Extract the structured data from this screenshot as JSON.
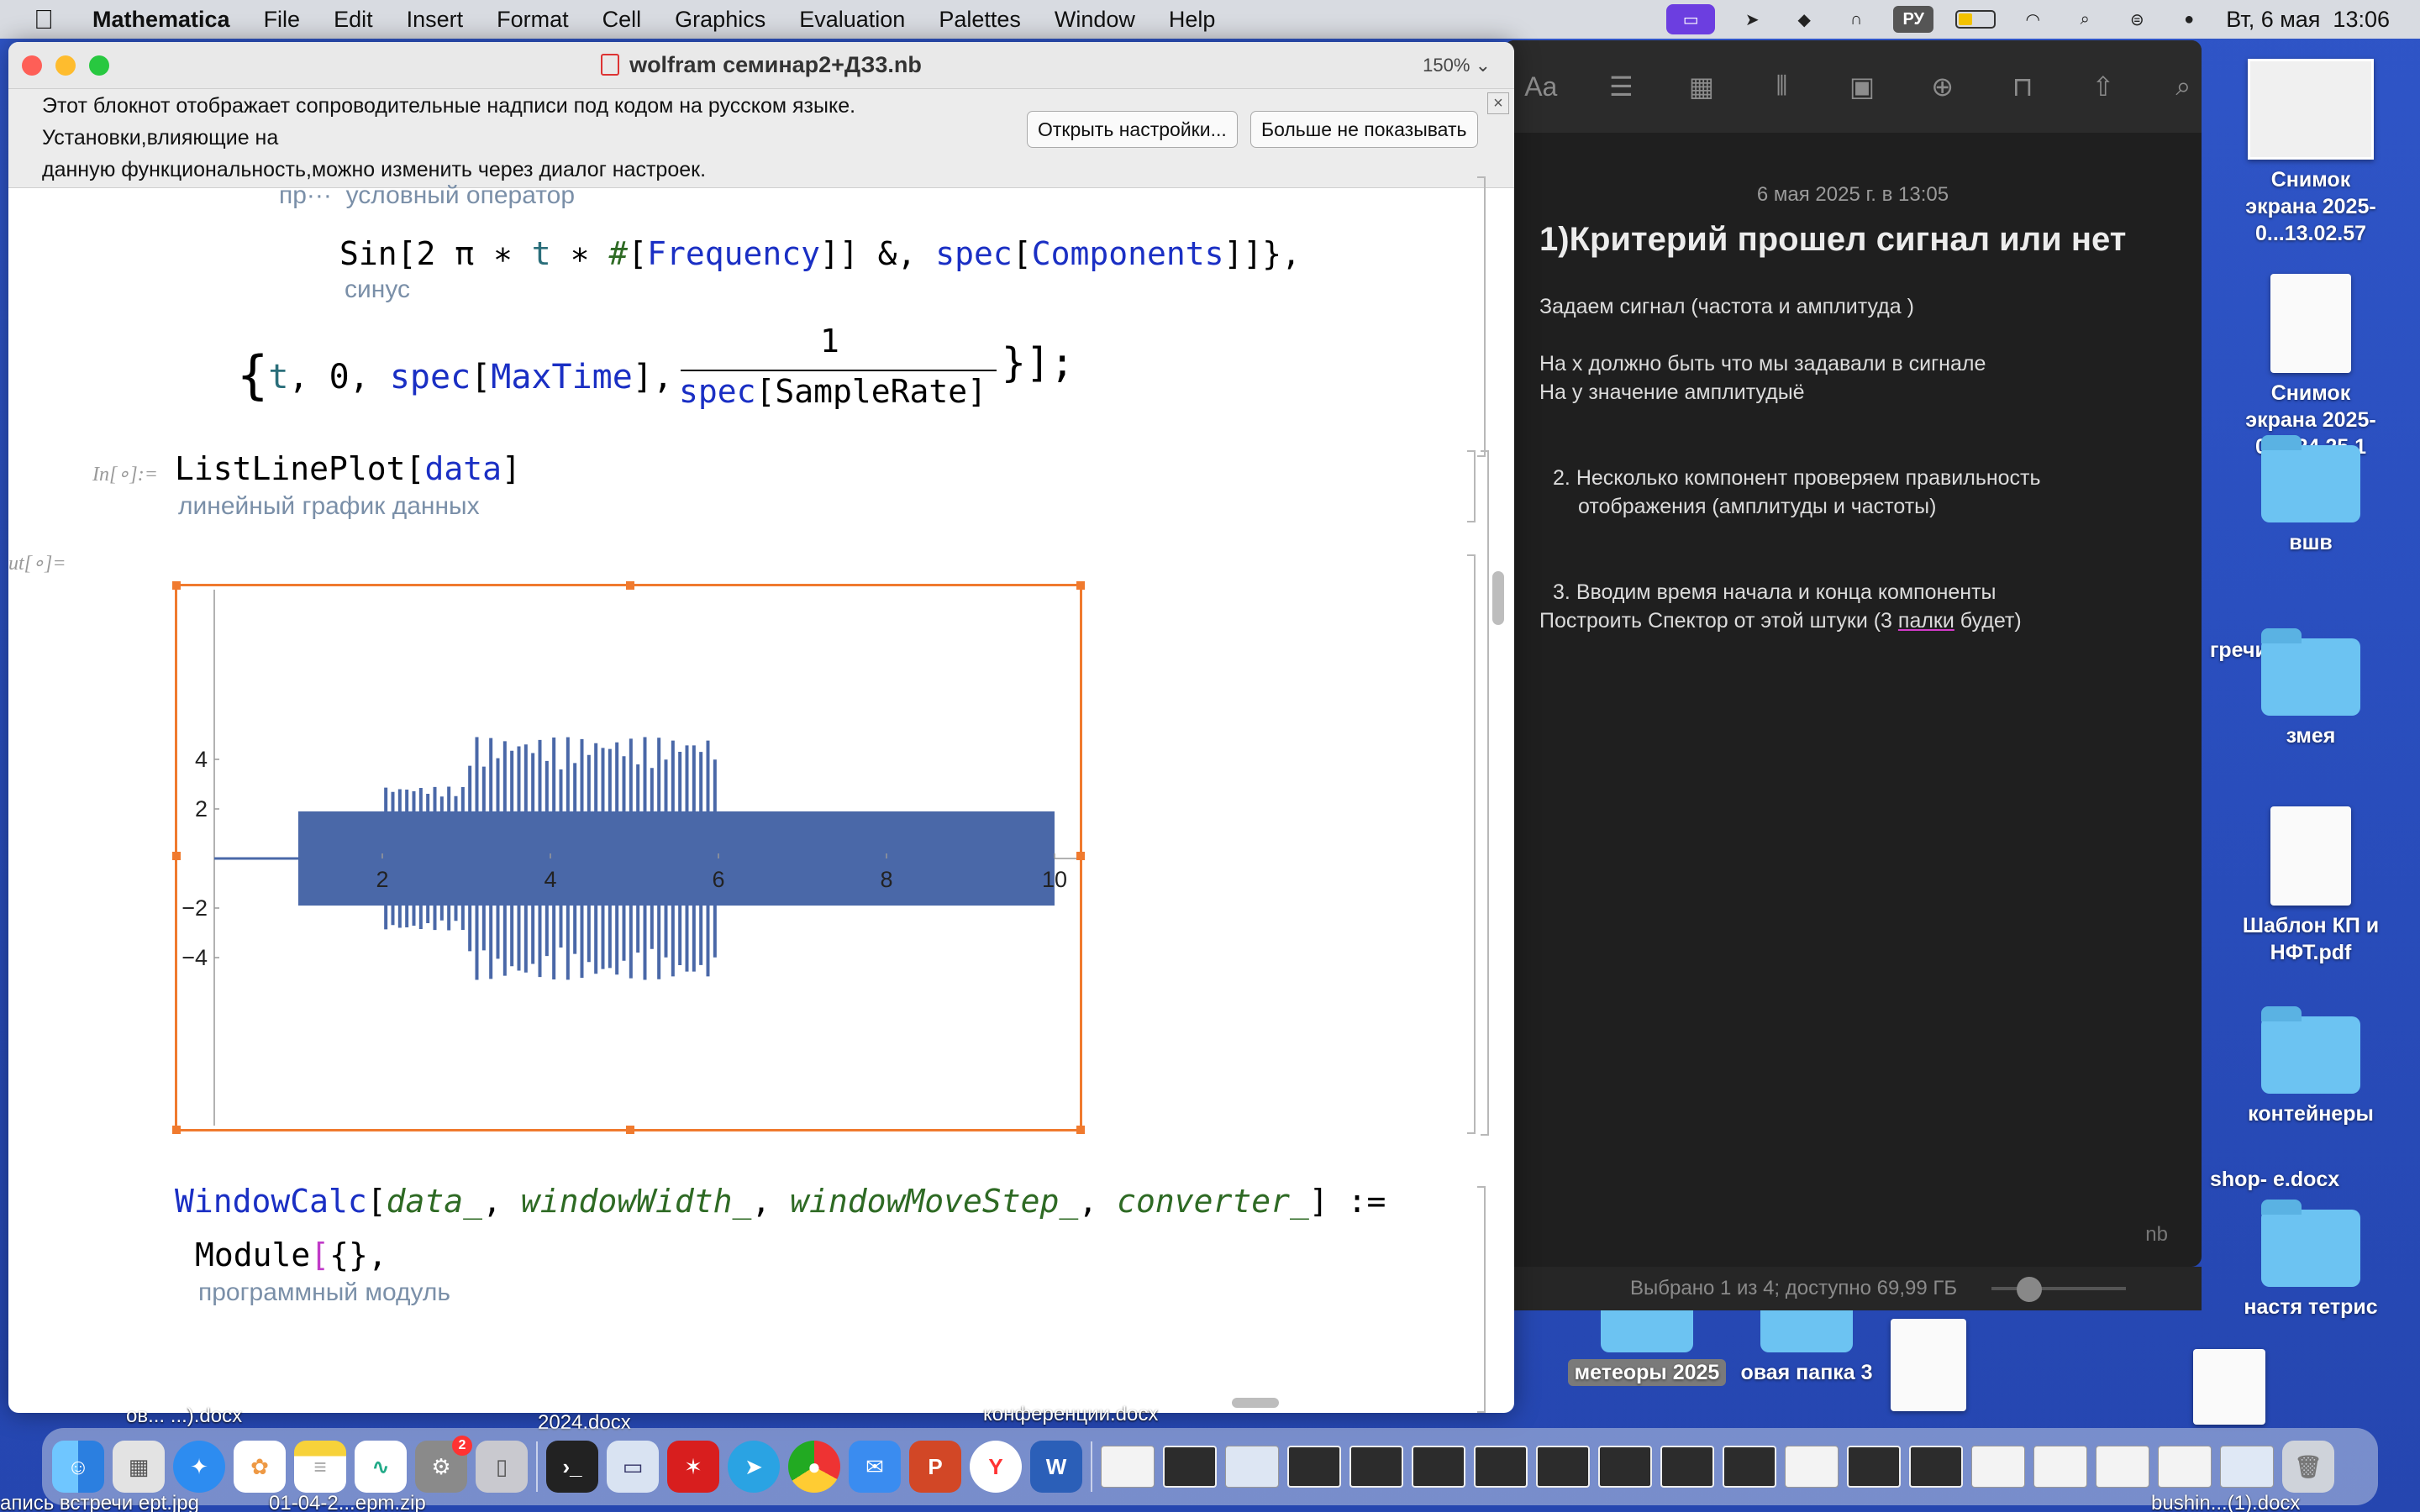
{
  "menubar": {
    "app_name": "Mathematica",
    "items": [
      "File",
      "Edit",
      "Insert",
      "Format",
      "Cell",
      "Graphics",
      "Evaluation",
      "Palettes",
      "Window",
      "Help"
    ],
    "keyboard_layout": "РУ",
    "clock": "Вт, 6 мая  13:06"
  },
  "notebook": {
    "title": "wolfram семинар2+ДЗ3.nb",
    "zoom": "150%",
    "banner": {
      "line1": "Этот блокнот отображает сопроводительные надписи под кодом на русском языке.",
      "line2": "Установки,влияющие на",
      "line3": "данную функциональность,можно изменить через диалог настроек.",
      "open_settings": "Открыть настройки...",
      "dont_show": "Больше не показывать",
      "close": "×"
    },
    "cell1": {
      "hint_top_a": "пр···",
      "hint_top_b": "условный оператор",
      "line_sin_a": "Sin[2",
      "line_sin_pi": " π ",
      "line_sin_b": "∗",
      "line_sin_t": " t ",
      "line_sin_c": "∗ ",
      "line_sin_hash": "#",
      "line_sin_d": "[",
      "line_sin_freq": "Frequency",
      "line_sin_e": "]] &, ",
      "line_sin_spec": "spec",
      "line_sin_f": "[",
      "line_sin_comp": "Components",
      "line_sin_g": "]]},",
      "hint_sin": "синус",
      "range_open": "{",
      "range_t": "t",
      "range_zero": ", 0, ",
      "range_spec": "spec",
      "range_b1": "[",
      "range_max": "MaxTime",
      "range_b2": "], ",
      "frac_num": "1",
      "frac_spec": "spec",
      "frac_b1": "[",
      "frac_rate": "SampleRate",
      "frac_b2": "]",
      "range_close": "}];"
    },
    "cell2": {
      "in_label": "In[∘]:=",
      "fn": "ListLinePlot",
      "b1": "[",
      "arg": "data",
      "b2": "]",
      "hint": "линейный график данных",
      "out_label": "ut[∘]="
    },
    "cell3": {
      "fn": "WindowCalc",
      "open": "[",
      "a1": "data_",
      "a2": "windowWidth_",
      "a3": "windowMoveStep_",
      "a4": "converter_",
      "sep": ", ",
      "close": "] :=",
      "module_kw": "Module",
      "module_b1": "[",
      "module_rest": "{},",
      "hint": "программный модуль"
    }
  },
  "chart_data": {
    "type": "line",
    "title": "",
    "xlabel": "",
    "ylabel": "",
    "xlim": [
      0,
      10
    ],
    "ylim": [
      -5.2,
      5.2
    ],
    "x_ticks": [
      2,
      4,
      6,
      8,
      10
    ],
    "y_ticks": [
      -4,
      -2,
      2,
      4
    ],
    "x_tick_labels": [
      "2",
      "4",
      "6",
      "8",
      "10"
    ],
    "y_tick_labels": [
      "−4",
      "−2",
      "2",
      "4"
    ],
    "color": "#4a68a8",
    "segments": [
      {
        "x_start": 0,
        "x_end": 1,
        "amplitude": 0
      },
      {
        "x_start": 1,
        "x_end": 2,
        "amplitude": 1.9
      },
      {
        "x_start": 2,
        "x_end": 3,
        "amplitude": 2.9
      },
      {
        "x_start": 3,
        "x_end": 6,
        "amplitude": 4.9
      },
      {
        "x_start": 6,
        "x_end": 10,
        "amplitude": 1.9
      }
    ]
  },
  "notes": {
    "date": "6 мая 2025 г. в 13:05",
    "title": "1)Критерий прошел сигнал или нет",
    "p1": "Задаем сигнал (частота и амплитуда )",
    "p2": "На х должно быть что мы задавали в сигнале",
    "p3": "На у значение амплитудыё",
    "p4_num": "2.",
    "p4": "Несколько компонент проверяем правильность отображения (амплитуды и частоты)",
    "p5_num": "3.",
    "p5": "Вводим время начала и конца компоненты",
    "p6a": "Построить Спектор от этой штуки (3 ",
    "p6b": "палки",
    "p6c": " будет)",
    "finder_status": "Выбрано 1 из 4; доступно 69,99 ГБ",
    "fragment": "nb"
  },
  "desktop": {
    "icons": [
      "Снимок экрана 2025-0...13.02.57",
      "Снимок экрана 2025-02...24.25.1",
      "вшв",
      "гречи_ .webm",
      "змея",
      "Шаблон КП и НФТ.pdf",
      "контейнеры",
      "shop- e.docx",
      "настя тетрис"
    ],
    "behind": {
      "meteors": "метеоры 2025",
      "folder3": "овая папка 3",
      "bottom1": "ов... ...).docx",
      "bottom2": "2024.docx",
      "bottom3": "конференции.docx",
      "bottom4": "апись встречи ept.jpg",
      "bottom5": "01-04-2...epm.zip",
      "bottom6": "bushin...(1).docx"
    }
  },
  "dock": {
    "badge": "2"
  }
}
